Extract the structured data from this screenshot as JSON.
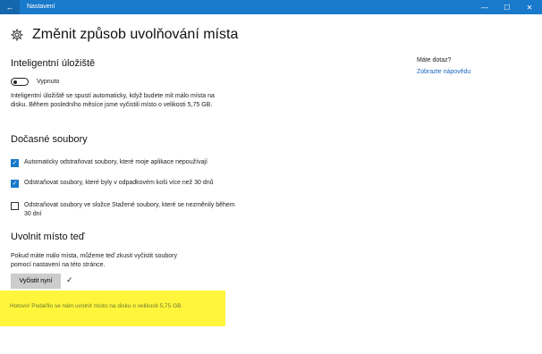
{
  "window": {
    "title": "Nastavení",
    "back_glyph": "←",
    "minimize_glyph": "—",
    "maximize_glyph": "☐",
    "close_glyph": "✕"
  },
  "header": {
    "icon": "gear-icon",
    "title": "Změnit způsob uvolňování místa"
  },
  "storage_sense": {
    "heading": "Inteligentní úložiště",
    "toggle_label": "Vypnuto",
    "toggle_on": false,
    "description": "Inteligentní úložiště se spustí automaticky, když budete mít málo místa na disku. Během posledního měsíce jsme vyčistili místo o velikosti 5,75 GB."
  },
  "temp_files": {
    "heading": "Dočasné soubory",
    "options": [
      {
        "label": "Automaticky odstraňovat soubory, které moje aplikace nepoužívají",
        "checked": true
      },
      {
        "label": "Odstraňovat soubory, které byly v odpadkovém koši více než 30 dnů",
        "checked": true
      },
      {
        "label": "Odstraňovat soubory ve složce Stažené soubory, které se nezměnily během 30 dní",
        "checked": false
      }
    ]
  },
  "free_now": {
    "heading": "Uvolnit místo teď",
    "description": "Pokud máte málo místa, můžeme teď zkusit vyčistit soubory pomocí nastavení na této stránce.",
    "button_label": "Vyčistit nyní",
    "done_glyph": "✓",
    "result": "Hotovo! Podařilo se nám uvolnit místo na disku o velikosti 5,75 GB."
  },
  "sidebar": {
    "question": "Máte dotaz?",
    "help_link": "Zobrazte nápovědu"
  },
  "colors": {
    "accent": "#1979ca",
    "highlight": "#fff63c",
    "link": "#1a64c0"
  }
}
